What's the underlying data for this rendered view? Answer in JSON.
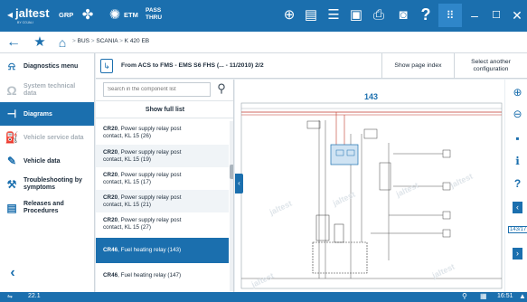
{
  "app": {
    "brand": "jaltest",
    "brand_sub": "BY COJALI",
    "mode_grp": "GRP",
    "mode_etm": "ETM",
    "mode_pass_1": "PASS",
    "mode_pass_2": "THRU",
    "accent": "#1b6fae"
  },
  "breadcrumb": {
    "items": [
      "BUS",
      "SCANIA",
      "K 420 EB"
    ],
    "separator": ">"
  },
  "sidebar": {
    "items": [
      {
        "label": "Diagnostics menu",
        "icon": "diagnostics-icon"
      },
      {
        "label": "System technical data",
        "icon": "omega-icon"
      },
      {
        "label": "Diagrams",
        "icon": "diagram-icon"
      },
      {
        "label": "Vehicle service data",
        "icon": "oil-can-icon"
      },
      {
        "label": "Vehicle data",
        "icon": "wrench-icon"
      },
      {
        "label": "Troubleshooting by symptoms",
        "icon": "troubleshoot-icon"
      },
      {
        "label": "Releases and Procedures",
        "icon": "document-icon"
      }
    ],
    "back_icon": "chevron-left-icon"
  },
  "header": {
    "diagram_title": "From ACS to FMS - EMS S6 FHS (... - 11/2010) 2/2",
    "show_page_index": "Show page index",
    "select_config_1": "Select another",
    "select_config_2": "configuration"
  },
  "search": {
    "placeholder": "Search in the component list",
    "show_full_list": "Show full list"
  },
  "components": [
    {
      "code": "CR20",
      "line1": ", Power supply relay post",
      "line2": "contact, KL 15 (26)"
    },
    {
      "code": "CR20",
      "line1": ", Power supply relay post",
      "line2": "contact, KL 15 (19)"
    },
    {
      "code": "CR20",
      "line1": ", Power supply relay post",
      "line2": "contact, KL 15 (17)"
    },
    {
      "code": "CR20",
      "line1": ", Power supply relay post",
      "line2": "contact, KL 15 (21)"
    },
    {
      "code": "CR20",
      "line1": ", Power supply relay post",
      "line2": "contact, KL 15 (27)"
    },
    {
      "code": "CR46",
      "line1": ", Fuel heating relay (143)",
      "line2": ""
    },
    {
      "code": "CR46",
      "line1": ", Fuel heating relay (147)",
      "line2": ""
    }
  ],
  "diagram": {
    "page_number": "143",
    "watermark": "jaltest"
  },
  "right_toolbar": {
    "zoom_in": "zoom-in-icon",
    "zoom_out": "zoom-out-icon",
    "page_label": "143/17"
  },
  "status": {
    "version": "22.1",
    "time": "16:51"
  }
}
